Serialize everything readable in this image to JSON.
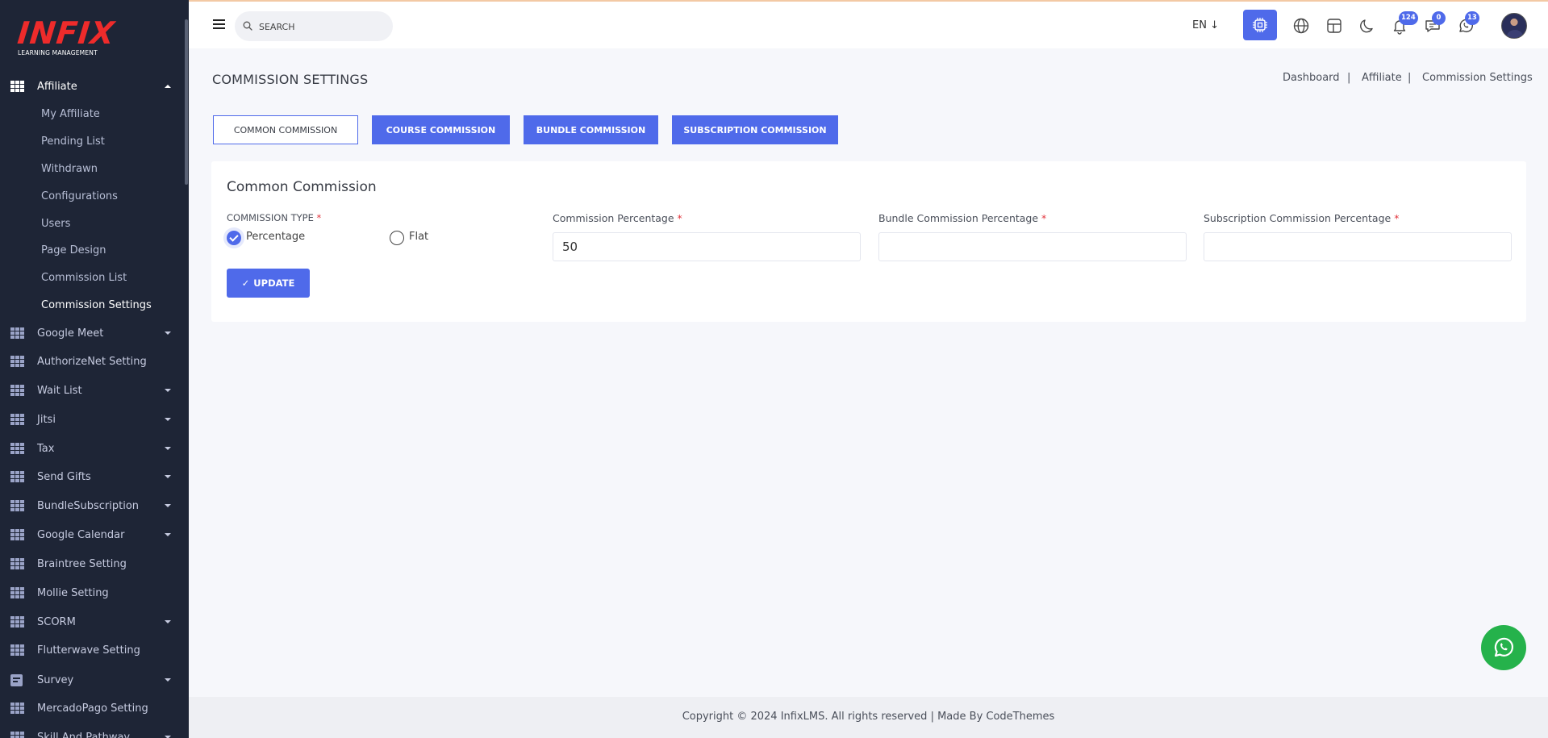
{
  "brand": {
    "logo": "INFIX",
    "tagline": "LEARNING MANAGEMENT"
  },
  "sidebar": {
    "active_group": {
      "label": "Affiliate"
    },
    "sub_items": [
      {
        "label": "My Affiliate"
      },
      {
        "label": "Pending List"
      },
      {
        "label": "Withdrawn"
      },
      {
        "label": "Configurations"
      },
      {
        "label": "Users"
      },
      {
        "label": "Page Design"
      },
      {
        "label": "Commission List"
      },
      {
        "label": "Commission Settings"
      }
    ],
    "items": [
      {
        "label": "Google Meet"
      },
      {
        "label": "AuthorizeNet Setting"
      },
      {
        "label": "Wait List"
      },
      {
        "label": "Jitsi"
      },
      {
        "label": "Tax"
      },
      {
        "label": "Send Gifts"
      },
      {
        "label": "BundleSubscription"
      },
      {
        "label": "Google Calendar"
      },
      {
        "label": "Braintree Setting"
      },
      {
        "label": "Mollie Setting"
      },
      {
        "label": "SCORM"
      },
      {
        "label": "Flutterwave Setting"
      },
      {
        "label": "Survey"
      },
      {
        "label": "MercadoPago Setting"
      },
      {
        "label": "Skill And Pathway"
      }
    ]
  },
  "header": {
    "search_placeholder": "SEARCH",
    "language": "EN ↓",
    "notifications_count": "124",
    "messages_count": "0",
    "whatsapp_count": "13"
  },
  "page": {
    "title": "COMMISSION SETTINGS",
    "breadcrumb": [
      "Dashboard",
      "Affiliate",
      "Commission Settings"
    ],
    "breadcrumb_sep": "|",
    "tabs": [
      {
        "label": "COMMON COMMISSION"
      },
      {
        "label": "COURSE COMMISSION"
      },
      {
        "label": "BUNDLE COMMISSION"
      },
      {
        "label": "SUBSCRIPTION COMMISSION"
      }
    ],
    "active_tab": "COMMON COMMISSION"
  },
  "form": {
    "title": "Common Commission",
    "required_mark": "*",
    "commission_type_label": "COMMISSION TYPE",
    "option_percentage": "Percentage",
    "option_flat": "Flat",
    "selected_type": "Percentage",
    "commission_percentage_label": "Commission Percentage",
    "commission_percentage_value": "50",
    "bundle_percentage_label": "Bundle Commission Percentage",
    "bundle_percentage_value": "",
    "subscription_percentage_label": "Subscription Commission Percentage",
    "subscription_percentage_value": "",
    "update_label": "UPDATE",
    "update_check": "✓"
  },
  "footer": {
    "text": "Copyright © 2024 InfixLMS. All rights reserved | Made By CodeThemes"
  },
  "colors": {
    "accent": "#4f6aea",
    "sidebar": "#1e2536",
    "whatsapp": "#25b24b",
    "required": "#e2353d",
    "logo": "#ee2b2b"
  }
}
